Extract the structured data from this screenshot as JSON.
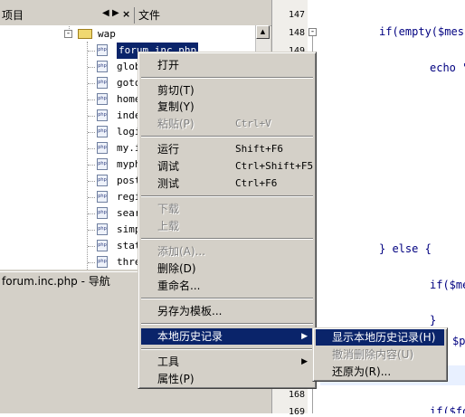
{
  "tabs": {
    "project": "项目",
    "files": "文件"
  },
  "tree": {
    "folder": "wap",
    "files": [
      "forum.inc.php",
      "glob",
      "goto",
      "home",
      "inde",
      "logi",
      "my.i",
      "myph",
      "post",
      "regi",
      "sear",
      "simp",
      "stat",
      "thre"
    ]
  },
  "navigator": {
    "title": "forum.inc.php - 导航"
  },
  "editor": {
    "line_numbers": [
      "147",
      "148",
      "149",
      "168",
      "169"
    ],
    "code": [
      {
        "text": "if(empty($mess"
      },
      {
        "text": "echo \""
      },
      {
        "text": "} else {"
      },
      {
        "text": "if($me"
      },
      {
        "text": "}"
      },
      {
        "text": "$po"
      },
      {
        "text": "if($fo"
      }
    ]
  },
  "context_menu": {
    "items": [
      {
        "label": "打开",
        "shortcut": ""
      },
      {
        "label": "剪切(T)",
        "shortcut": ""
      },
      {
        "label": "复制(Y)",
        "shortcut": ""
      },
      {
        "label": "粘贴(P)",
        "shortcut": "Ctrl+V"
      },
      {
        "label": "运行",
        "shortcut": "Shift+F6"
      },
      {
        "label": "调试",
        "shortcut": "Ctrl+Shift+F5"
      },
      {
        "label": "测试",
        "shortcut": "Ctrl+F6"
      },
      {
        "label": "下载",
        "shortcut": ""
      },
      {
        "label": "上载",
        "shortcut": ""
      },
      {
        "label": "添加(A)...",
        "shortcut": ""
      },
      {
        "label": "删除(D)",
        "shortcut": ""
      },
      {
        "label": "重命名...",
        "shortcut": ""
      },
      {
        "label": "另存为模板...",
        "shortcut": ""
      },
      {
        "label": "本地历史记录",
        "shortcut": ""
      },
      {
        "label": "工具",
        "shortcut": ""
      },
      {
        "label": "属性(P)",
        "shortcut": ""
      }
    ]
  },
  "submenu": {
    "items": [
      {
        "label": "显示本地历史记录(H)"
      },
      {
        "label": "撤消删除内容(U)"
      },
      {
        "label": "还原为(R)..."
      }
    ]
  },
  "colors": {
    "selection": "#0a246a",
    "menu_bg": "#d4d0c8",
    "code": "#000080"
  }
}
